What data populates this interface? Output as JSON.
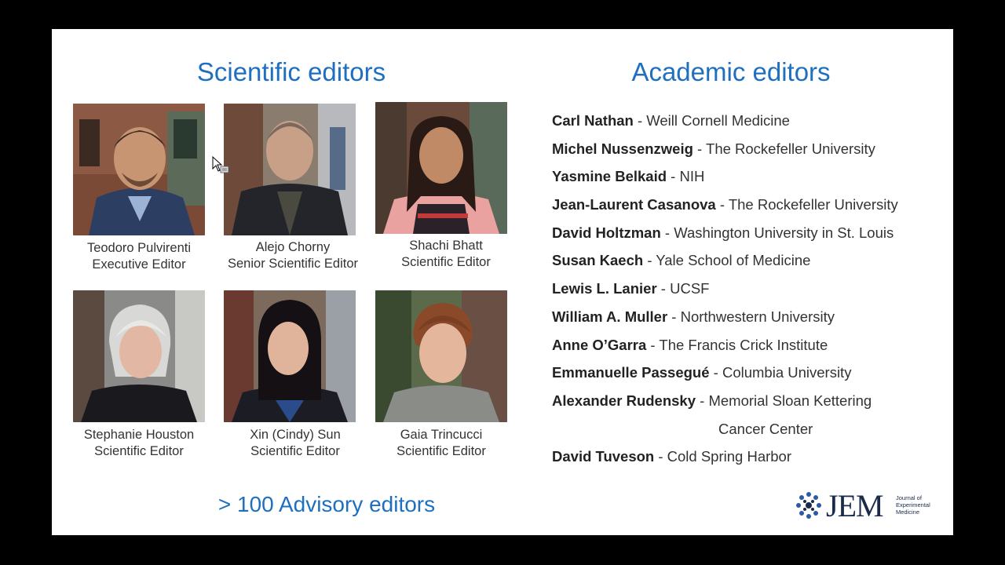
{
  "slide": {
    "scientific_heading": "Scientific editors",
    "academic_heading": "Academic editors",
    "advisory_text": "> 100 Advisory editors",
    "scientific_editors": [
      {
        "name": "Teodoro Pulvirenti",
        "role": "Executive Editor"
      },
      {
        "name": "Alejo Chorny",
        "role": "Senior Scientific Editor"
      },
      {
        "name": "Shachi Bhatt",
        "role": "Scientific Editor"
      },
      {
        "name": "Stephanie Houston",
        "role": "Scientific Editor"
      },
      {
        "name": "Xin (Cindy) Sun",
        "role": "Scientific Editor"
      },
      {
        "name": "Gaia Trincucci",
        "role": "Scientific Editor"
      }
    ],
    "academic_editors": [
      {
        "name": "Carl Nathan",
        "affiliation": " - Weill Cornell Medicine"
      },
      {
        "name": "Michel Nussenzweig",
        "affiliation": " - The Rockefeller University"
      },
      {
        "name": "Yasmine Belkaid",
        "affiliation": " - NIH"
      },
      {
        "name": "Jean-Laurent Casanova",
        "affiliation": " - The Rockefeller University"
      },
      {
        "name": "David Holtzman",
        "affiliation": " - Washington University in St. Louis"
      },
      {
        "name": "Susan Kaech",
        "affiliation": " - Yale School of Medicine"
      },
      {
        "name": "Lewis L. Lanier",
        "affiliation": " - UCSF"
      },
      {
        "name": "William A. Muller",
        "affiliation": " - Northwestern University"
      },
      {
        "name": "Anne O’Garra",
        "affiliation": " - The Francis Crick Institute"
      },
      {
        "name": "Emmanuelle Passegué",
        "affiliation": " - Columbia University"
      },
      {
        "name": "Alexander Rudensky",
        "affiliation": " - Memorial Sloan Kettering",
        "continuation": "Cancer Center"
      },
      {
        "name": "David Tuveson",
        "affiliation": " - Cold Spring Harbor"
      }
    ],
    "logo": {
      "wordmark": "JEM",
      "line1": "Journal of",
      "line2": "Experimental",
      "line3": "Medicine"
    }
  },
  "colors": {
    "accent": "#1f6fc0",
    "background": "#000000",
    "slide": "#ffffff"
  }
}
